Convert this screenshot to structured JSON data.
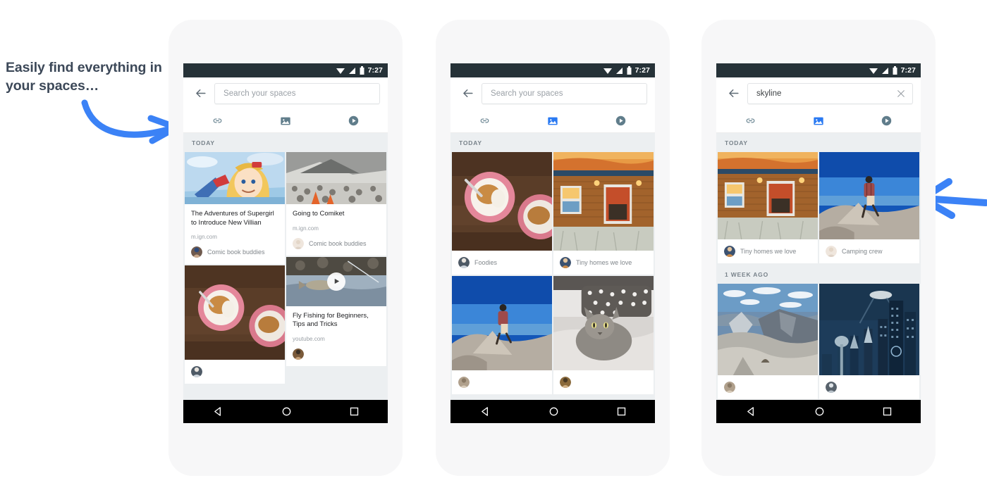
{
  "annotation": {
    "text": "Easily find everything in your spaces…",
    "arrow_color": "#3b82f6",
    "left_arrow_icon": "curved-arrow-right-icon",
    "right_arrow_icon": "arrow-left-icon"
  },
  "colors": {
    "accent_blue": "#3b82f6",
    "tab_active": "#2979f2",
    "tab_inactive": "#607d8b",
    "statusbar": "#263238",
    "feed_bg": "#eceff1",
    "phone_body": "#f7f7f8"
  },
  "statusbar": {
    "time": "7:27",
    "icons": [
      "wifi-icon",
      "signal-icon",
      "battery-icon"
    ]
  },
  "navbar": {
    "items": [
      "back-triangle-icon",
      "home-circle-icon",
      "recents-square-icon"
    ]
  },
  "phones": [
    {
      "id": "phone-1",
      "search": {
        "value": "",
        "placeholder": "Search your spaces",
        "has_clear": false,
        "back_icon": "arrow-back-icon"
      },
      "tabs": [
        {
          "name": "links",
          "icon": "link-icon",
          "active": false
        },
        {
          "name": "photos",
          "icon": "image-icon",
          "active": false
        },
        {
          "name": "videos",
          "icon": "play-circle-icon",
          "active": false
        }
      ],
      "sections": [
        {
          "header": "TODAY",
          "columns": [
            {
              "cards": [
                {
                  "type": "article",
                  "image": "supergirl-comic",
                  "title": "The Adventures of Supergirl to Introduce New Villian",
                  "source": "m.ign.com",
                  "space": "Comic book buddies",
                  "avatar": "avatar-comic-1"
                },
                {
                  "type": "photo",
                  "image": "fried-chicken-plates",
                  "title": "",
                  "source": "",
                  "space": "",
                  "avatar": "avatar-foodies"
                }
              ]
            },
            {
              "cards": [
                {
                  "type": "article",
                  "image": "comiket-crowd",
                  "title": "Going to Comiket",
                  "source": "m.ign.com",
                  "space": "Comic book buddies",
                  "avatar": "avatar-comic-2"
                },
                {
                  "type": "video",
                  "image": "fly-fishing",
                  "title": "Fly Fishing for Beginners, Tips and Tricks",
                  "source": "youtube.com",
                  "space": "",
                  "avatar": "avatar-fishing"
                }
              ]
            }
          ]
        }
      ]
    },
    {
      "id": "phone-2",
      "search": {
        "value": "",
        "placeholder": "Search your spaces",
        "has_clear": false,
        "back_icon": "arrow-back-icon"
      },
      "tabs": [
        {
          "name": "links",
          "icon": "link-icon",
          "active": false
        },
        {
          "name": "photos",
          "icon": "image-icon",
          "active": true
        },
        {
          "name": "videos",
          "icon": "play-circle-icon",
          "active": false
        }
      ],
      "sections": [
        {
          "header": "TODAY",
          "columns": [
            {
              "cards": [
                {
                  "type": "photo",
                  "image": "fried-chicken-plates",
                  "space": "Foodies",
                  "avatar": "avatar-foodies"
                },
                {
                  "type": "photo",
                  "image": "hiker-on-rocks",
                  "space": "",
                  "avatar": "avatar-camping"
                }
              ]
            },
            {
              "cards": [
                {
                  "type": "photo",
                  "image": "cabin-sunset",
                  "space": "Tiny homes we love",
                  "avatar": "avatar-tinyhomes"
                },
                {
                  "type": "photo",
                  "image": "cat-on-bed",
                  "space": "",
                  "avatar": "avatar-cat"
                }
              ]
            }
          ]
        }
      ]
    },
    {
      "id": "phone-3",
      "search": {
        "value": "skyline",
        "placeholder": "Search your spaces",
        "has_clear": true,
        "back_icon": "arrow-back-icon",
        "clear_icon": "close-icon"
      },
      "tabs": [
        {
          "name": "links",
          "icon": "link-icon",
          "active": false
        },
        {
          "name": "photos",
          "icon": "image-icon",
          "active": true
        },
        {
          "name": "videos",
          "icon": "play-circle-icon",
          "active": false
        }
      ],
      "sections": [
        {
          "header": "TODAY",
          "columns": [
            {
              "cards": [
                {
                  "type": "photo",
                  "image": "cabin-sunset",
                  "space": "Tiny homes we love",
                  "avatar": "avatar-tinyhomes"
                },
                {
                  "type": "photo",
                  "image": "yosemite-valley",
                  "space": "",
                  "avatar": "avatar-camping"
                }
              ]
            },
            {
              "cards": [
                {
                  "type": "photo",
                  "image": "hiker-on-rocks",
                  "space": "Camping crew",
                  "avatar": "avatar-camping2"
                },
                {
                  "type": "photo",
                  "image": "future-city-skyline",
                  "space": "",
                  "avatar": "avatar-scifi"
                }
              ]
            }
          ]
        },
        {
          "header": "1 WEEK AGO"
        }
      ]
    }
  ]
}
